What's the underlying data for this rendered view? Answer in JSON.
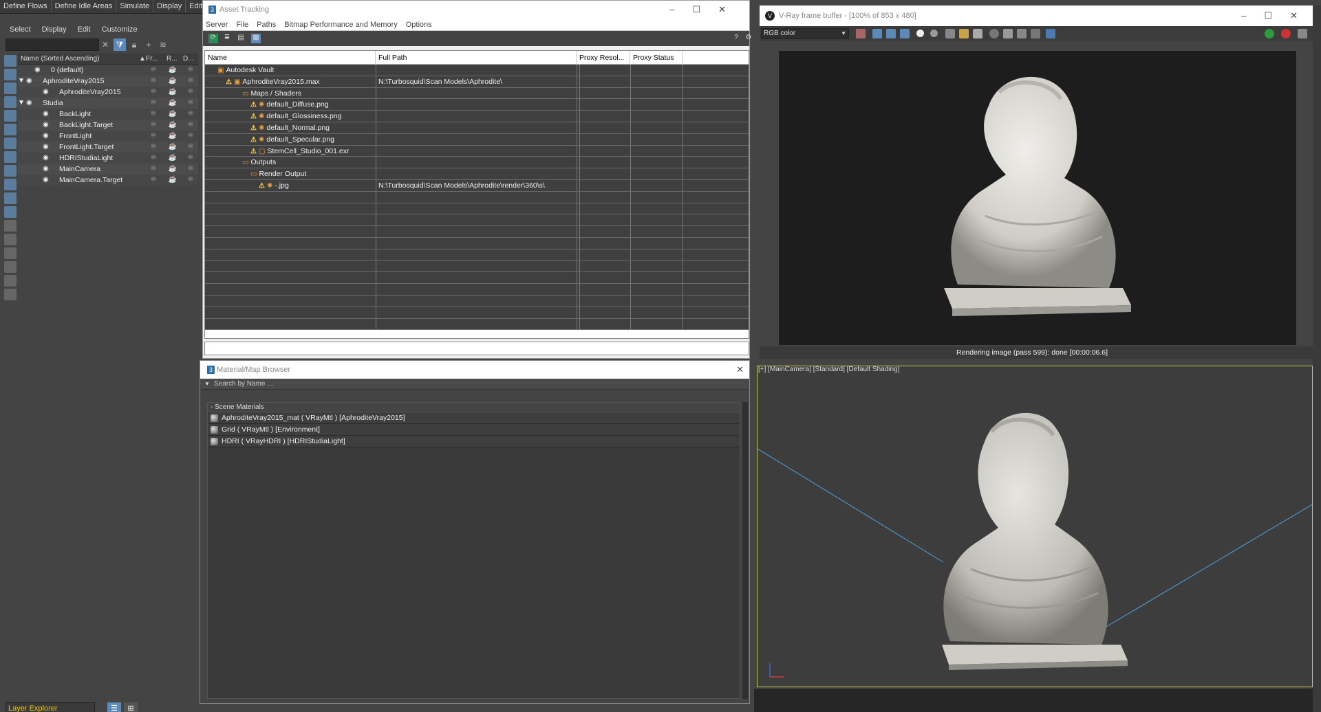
{
  "top_menu": [
    "Define Flows",
    "Define Idle Areas",
    "Simulate",
    "Display",
    "Edit"
  ],
  "scene_explorer": {
    "menu": [
      "Select",
      "Display",
      "Edit",
      "Customize"
    ],
    "columns": {
      "name": "Name (Sorted Ascending)",
      "c1": "Fr...",
      "c2": "R...",
      "c3": "D..."
    },
    "rows": [
      {
        "label": "0 (default)",
        "indent": 1
      },
      {
        "label": "AphroditeVray2015",
        "indent": 0
      },
      {
        "label": "AphroditeVray2015",
        "indent": 2
      },
      {
        "label": "Studia",
        "indent": 0
      },
      {
        "label": "BackLight",
        "indent": 2
      },
      {
        "label": "BackLight.Target",
        "indent": 2
      },
      {
        "label": "FrontLight",
        "indent": 2
      },
      {
        "label": "FrontLight.Target",
        "indent": 2
      },
      {
        "label": "HDRIStudiaLight",
        "indent": 2
      },
      {
        "label": "MainCamera",
        "indent": 2
      },
      {
        "label": "MainCamera.Target",
        "indent": 2
      }
    ],
    "layer_dropdown": "Layer Explorer"
  },
  "asset_tracking": {
    "title": "Asset Tracking",
    "menu": [
      "Server",
      "File",
      "Paths",
      "Bitmap Performance and Memory",
      "Options"
    ],
    "columns": [
      "Name",
      "Full Path",
      "Proxy Resol...",
      "Proxy Status"
    ],
    "rows": [
      {
        "name": "Autodesk Vault",
        "path": "",
        "indent": 18,
        "icon": "vault"
      },
      {
        "name": "AphroditeVray2015.max",
        "path": "N:\\Turbosquid\\Scan Models\\Aphrodite\\",
        "indent": 30,
        "icon": "max"
      },
      {
        "name": "Maps / Shaders",
        "path": "",
        "indent": 54,
        "icon": "folder"
      },
      {
        "name": "default_Diffuse.png",
        "path": "",
        "indent": 66,
        "icon": "map"
      },
      {
        "name": "default_Glossiness.png",
        "path": "",
        "indent": 66,
        "icon": "map"
      },
      {
        "name": "default_Normal.png",
        "path": "",
        "indent": 66,
        "icon": "map"
      },
      {
        "name": "default_Specular.png",
        "path": "",
        "indent": 66,
        "icon": "map"
      },
      {
        "name": "StemCell_Studio_001.exr",
        "path": "",
        "indent": 66,
        "icon": "exr"
      },
      {
        "name": "Outputs",
        "path": "",
        "indent": 54,
        "icon": "folder"
      },
      {
        "name": "Render Output",
        "path": "",
        "indent": 66,
        "icon": "folder"
      },
      {
        "name": "-.jpg",
        "path": "N:\\Turbosquid\\Scan Models\\Aphrodite\\render\\360\\s\\",
        "indent": 78,
        "icon": "map"
      }
    ],
    "empty_rows": 12
  },
  "material_browser": {
    "title": "Material/Map Browser",
    "search_placeholder": "Search by Name ...",
    "section": "- Scene Materials",
    "items": [
      "AphroditeVray2015_mat  ( VRayMtl )  [AphroditeVray2015]",
      "Grid  ( VRayMtl )  [Environment]",
      "HDRI  ( VRayHDRI )  [HDRIStudiaLight]"
    ]
  },
  "vray_fb": {
    "title": "V-Ray frame buffer - [100% of 853 x 480]",
    "channel": "RGB color",
    "status": "Rendering image (pass 599): done [00:00:06.6]"
  },
  "viewport": {
    "label": "[+] [MainCamera] [Standard] [Default Shading]"
  },
  "colors": {
    "accent_blue": "#5b89b8",
    "viewport_border": "#c8c842",
    "layer_text": "#f0c814",
    "warning": "#f2d25a"
  }
}
